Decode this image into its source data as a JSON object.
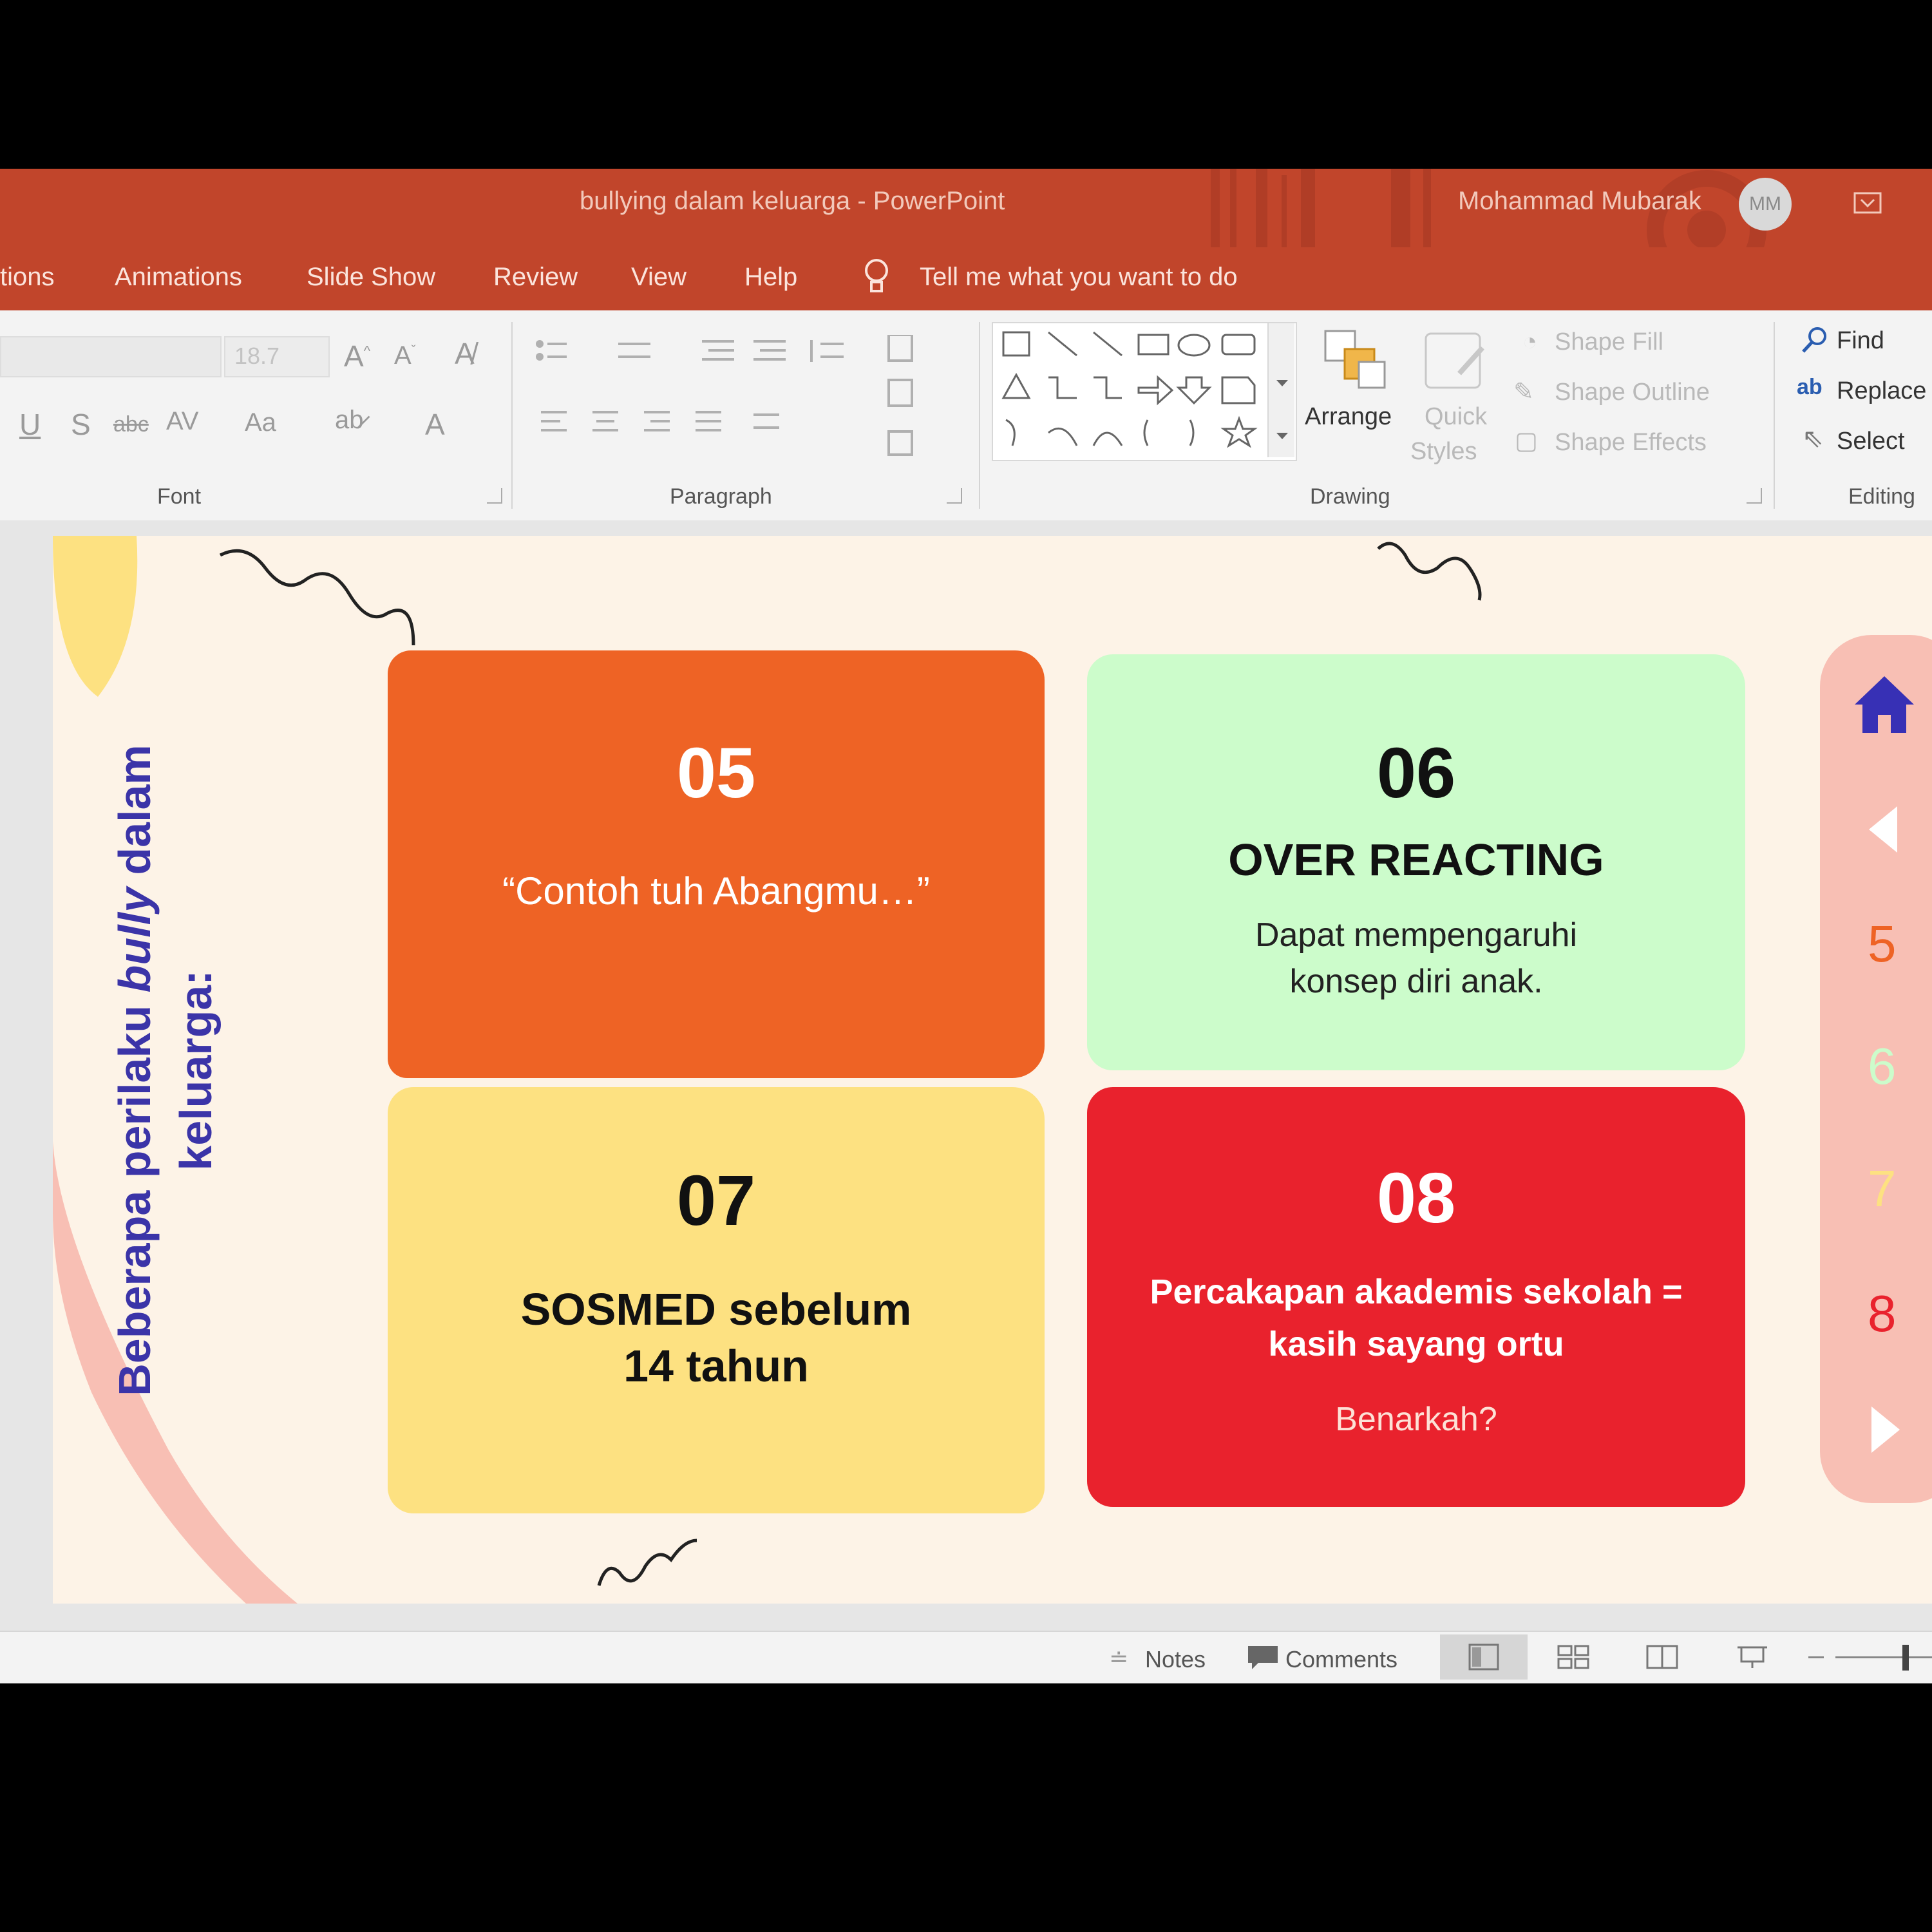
{
  "window": {
    "title": "bullying dalam keluarga  -  PowerPoint",
    "user_name": "Mohammad Mubarak",
    "avatar_initials": "MM"
  },
  "menu": {
    "tabs": [
      "tions",
      "Animations",
      "Slide Show",
      "Review",
      "View",
      "Help"
    ],
    "tell_me": "Tell me what you want to do"
  },
  "ribbon": {
    "font_size_value": "18.7",
    "groups": [
      "Font",
      "Paragraph",
      "Drawing",
      "Editing"
    ],
    "drawing": {
      "arrange": "Arrange",
      "quick_styles_1": "Quick",
      "quick_styles_2": "Styles",
      "shape_fill": "Shape Fill",
      "shape_outline": "Shape Outline",
      "shape_effects": "Shape Effects"
    },
    "editing": {
      "find": "Find",
      "replace": "Replace",
      "select": "Select"
    }
  },
  "slide": {
    "side_title_line1_pre": "Beberapa perilaku ",
    "side_title_line1_em": "bully",
    "side_title_line1_post": " dalam",
    "side_title_line2": "keluarga:",
    "cards": [
      {
        "number": "05",
        "heading": "",
        "text": "“Contoh tuh Abangmu…”",
        "color": "#EE6325"
      },
      {
        "number": "06",
        "heading": "OVER REACTING",
        "text": "Dapat mempengaruhi konsep diri anak.",
        "color": "#CCFCCB"
      },
      {
        "number": "07",
        "heading": "SOSMED sebelum 14 tahun",
        "text": "",
        "color": "#FDE181"
      },
      {
        "number": "08",
        "heading": "Percakapan akademis sekolah = kasih sayang ortu",
        "text": "Benarkah?",
        "color": "#E9222D"
      }
    ],
    "nav": {
      "numbers": [
        "5",
        "6",
        "7",
        "8"
      ],
      "colors": [
        "#EE6325",
        "#CCFCCB",
        "#FDE181",
        "#E9222D"
      ],
      "home_color": "#3730B5"
    }
  },
  "status": {
    "notes": "Notes",
    "comments": "Comments"
  },
  "colors": {
    "accent": "#C1452B",
    "slide_bg": "#fdf3e7",
    "title_text": "#3B34A8"
  }
}
